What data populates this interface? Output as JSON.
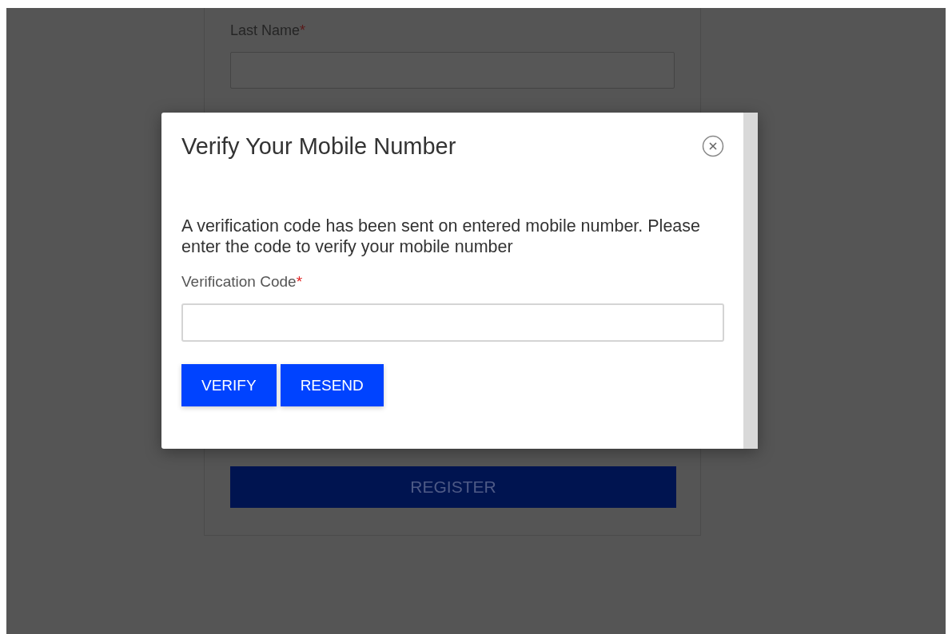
{
  "background_form": {
    "fields": [
      {
        "label": "Last Name",
        "required_mark": "*"
      }
    ],
    "register_button": "REGISTER"
  },
  "modal": {
    "title": "Verify Your Mobile Number",
    "message": "A verification code has been sent on entered mobile number. Please enter the code to verify your mobile number",
    "field": {
      "label": "Verification Code",
      "required_mark": "*"
    },
    "buttons": [
      {
        "label": "VERIFY"
      },
      {
        "label": "RESEND"
      }
    ]
  }
}
